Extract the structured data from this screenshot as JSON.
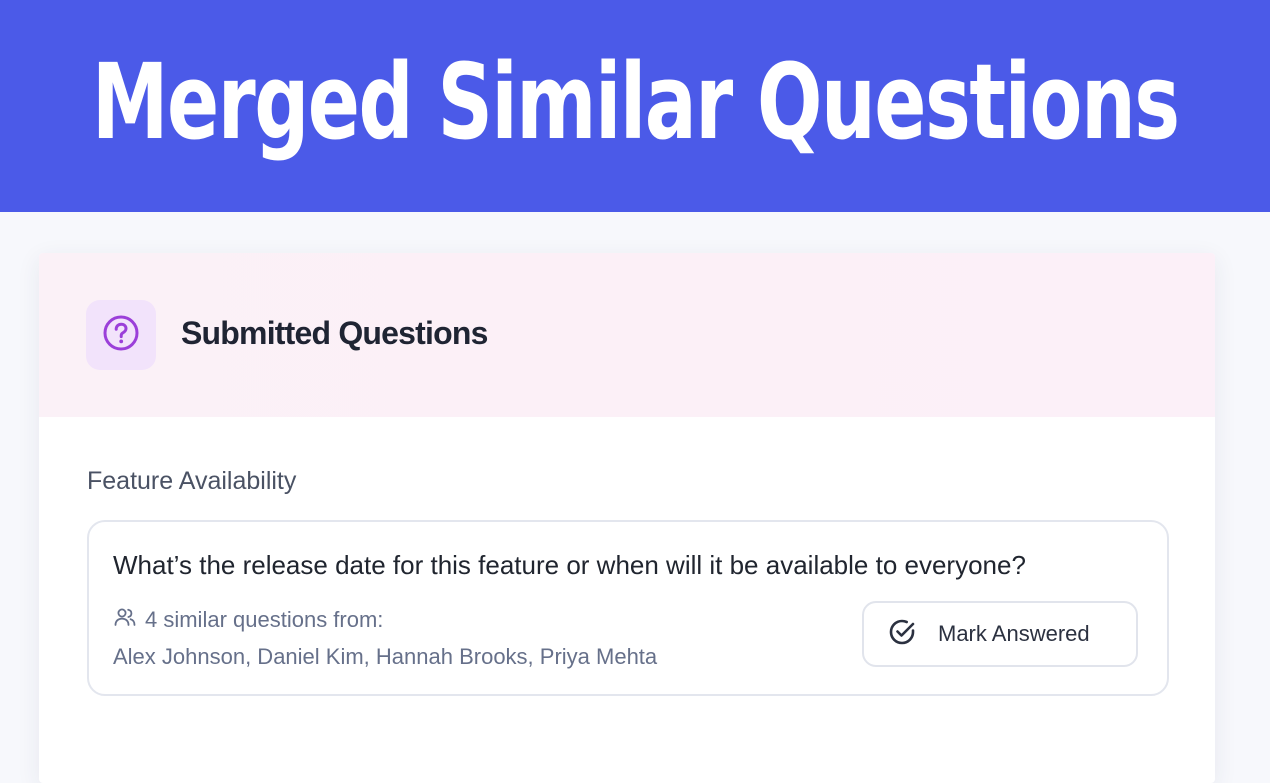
{
  "banner": {
    "title": "Merged Similar Questions"
  },
  "card": {
    "header_title": "Submitted Questions",
    "header_icon": "question-circle-icon",
    "accent_color": "#9b3fd9"
  },
  "section": {
    "label": "Feature Availability"
  },
  "question": {
    "text": "What’s the release date for this feature or when will it be available to everyone?",
    "similar_icon": "users-icon",
    "similar_text": "4 similar questions from:",
    "names": "Alex Johnson, Daniel Kim, Hannah Brooks, Priya Mehta",
    "button_icon": "check-circle-icon",
    "button_label": "Mark Answered"
  },
  "colors": {
    "banner_bg": "#4b5ae8",
    "header_bg": "#fbf1f7"
  }
}
